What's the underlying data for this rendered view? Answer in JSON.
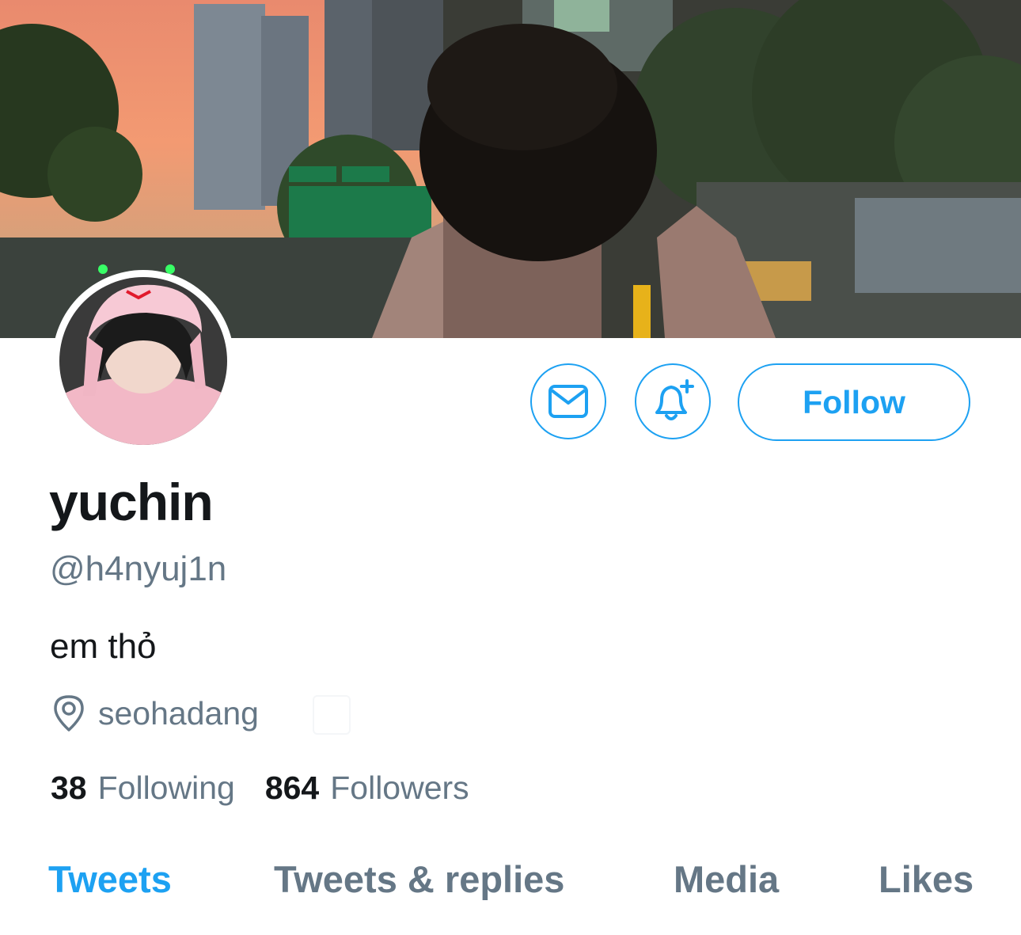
{
  "profile": {
    "name": "yuchin",
    "handle": "@h4nyuj1n",
    "bio": "em thỏ",
    "location": "seohadang"
  },
  "stats": {
    "following_count": "38",
    "following_label": "Following",
    "followers_count": "864",
    "followers_label": "Followers"
  },
  "actions": {
    "message_icon": "envelope-icon",
    "notify_icon": "bell-plus-icon",
    "follow_label": "Follow"
  },
  "tabs": [
    {
      "label": "Tweets",
      "active": true
    },
    {
      "label": "Tweets & replies",
      "active": false
    },
    {
      "label": "Media",
      "active": false
    },
    {
      "label": "Likes",
      "active": false
    }
  ],
  "colors": {
    "accent": "#1da1f2",
    "secondary_text": "#657786",
    "primary_text": "#14171a"
  }
}
